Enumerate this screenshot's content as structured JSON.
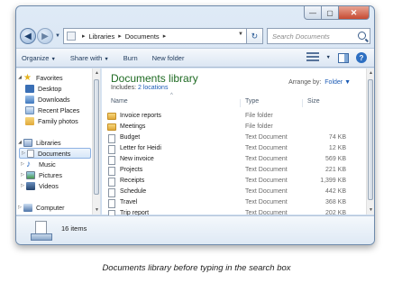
{
  "window": {
    "controls": {
      "minimize": "—",
      "maximize": "▢",
      "close": "✕"
    }
  },
  "address_bar": {
    "crumbs": [
      "Libraries",
      "Documents"
    ],
    "search_placeholder": "Search Documents"
  },
  "toolbar": {
    "organize": "Organize",
    "share_with": "Share with",
    "burn": "Burn",
    "new_folder": "New folder"
  },
  "nav_pane": {
    "favorites_label": "Favorites",
    "favorites": [
      "Desktop",
      "Downloads",
      "Recent Places",
      "Family photos"
    ],
    "libraries_label": "Libraries",
    "libraries": [
      "Documents",
      "Music",
      "Pictures",
      "Videos"
    ],
    "computer_label": "Computer"
  },
  "library": {
    "title": "Documents library",
    "includes_prefix": "Includes:",
    "includes_link": "2 locations",
    "arrange_by_label": "Arrange by:",
    "arrange_by_value": "Folder"
  },
  "columns": {
    "name": "Name",
    "type": "Type",
    "size": "Size"
  },
  "files": [
    {
      "name": "Invoice reports",
      "type": "File folder",
      "size": "",
      "icon": "folder-icon"
    },
    {
      "name": "Meetings",
      "type": "File folder",
      "size": "",
      "icon": "folder-icon"
    },
    {
      "name": "Budget",
      "type": "Text Document",
      "size": "74 KB",
      "icon": "document-icon"
    },
    {
      "name": "Letter for Heidi",
      "type": "Text Document",
      "size": "12 KB",
      "icon": "document-icon"
    },
    {
      "name": "New invoice",
      "type": "Text Document",
      "size": "569 KB",
      "icon": "document-icon"
    },
    {
      "name": "Projects",
      "type": "Text Document",
      "size": "221 KB",
      "icon": "document-icon"
    },
    {
      "name": "Receipts",
      "type": "Text Document",
      "size": "1,399 KB",
      "icon": "document-icon"
    },
    {
      "name": "Schedule",
      "type": "Text Document",
      "size": "442 KB",
      "icon": "document-icon"
    },
    {
      "name": "Travel",
      "type": "Text Document",
      "size": "368 KB",
      "icon": "document-icon"
    },
    {
      "name": "Trip report",
      "type": "Text Document",
      "size": "202 KB",
      "icon": "document-icon"
    }
  ],
  "details": {
    "item_count": "16 items"
  },
  "caption": "Documents library before typing in the search box",
  "colors": {
    "library_title": "#1e6a22",
    "link": "#1b5bb5",
    "close_button": "#c64a32"
  }
}
